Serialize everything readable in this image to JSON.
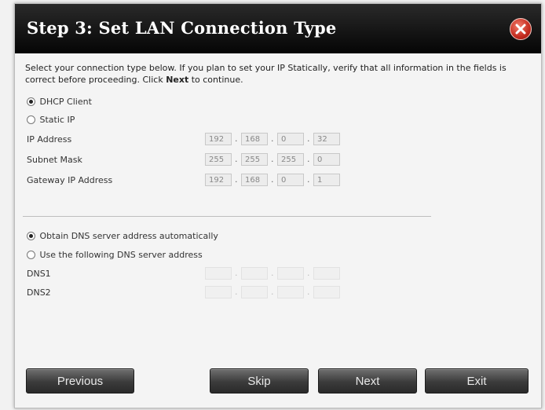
{
  "dialog": {
    "title": "Step 3: Set LAN Connection Type",
    "intro_part1": "Select your connection type below. If you plan to set your IP Statically, verify that all information in the fields is correct before proceeding. Click ",
    "intro_bold": "Next",
    "intro_part2": " to continue."
  },
  "connection": {
    "dhcp_label": "DHCP Client",
    "static_label": "Static IP",
    "selected": "DHCP Client"
  },
  "ip_fields": [
    {
      "label": "IP Address",
      "octets": [
        "192",
        "168",
        "0",
        "32"
      ]
    },
    {
      "label": "Subnet Mask",
      "octets": [
        "255",
        "255",
        "255",
        "0"
      ]
    },
    {
      "label": "Gateway IP Address",
      "octets": [
        "192",
        "168",
        "0",
        "1"
      ]
    }
  ],
  "dns": {
    "auto_label": "Obtain DNS server address automatically",
    "manual_label": "Use the following DNS server address",
    "selected": "Obtain DNS server address automatically",
    "dns1_label": "DNS1",
    "dns2_label": "DNS2"
  },
  "buttons": {
    "previous": "Previous",
    "skip": "Skip",
    "next": "Next",
    "exit": "Exit"
  },
  "colors": {
    "titlebar": "#000000",
    "close_button": "#d0392b"
  },
  "icons": {
    "close": "close-icon"
  }
}
